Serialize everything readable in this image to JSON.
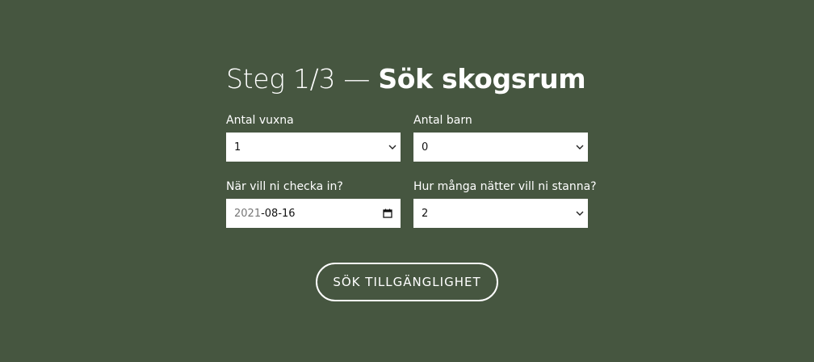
{
  "header": {
    "step_text": "Steg 1/3",
    "separator": "—",
    "title": "Sök skogsrum"
  },
  "form": {
    "adults": {
      "label": "Antal vuxna",
      "value": "1"
    },
    "children": {
      "label": "Antal barn",
      "value": "0"
    },
    "checkin": {
      "label": "När vill ni checka in?",
      "year": "2021",
      "rest": "-08-16"
    },
    "nights": {
      "label": "Hur många nätter vill ni stanna?",
      "value": "2"
    }
  },
  "search_button": {
    "label": "SÖK TILLGÄNGLIGHET"
  },
  "colors": {
    "background": "#465640",
    "text": "#ffffff",
    "field_bg": "#ffffff"
  },
  "icons": [
    "chevron-down-icon",
    "calendar-icon"
  ]
}
